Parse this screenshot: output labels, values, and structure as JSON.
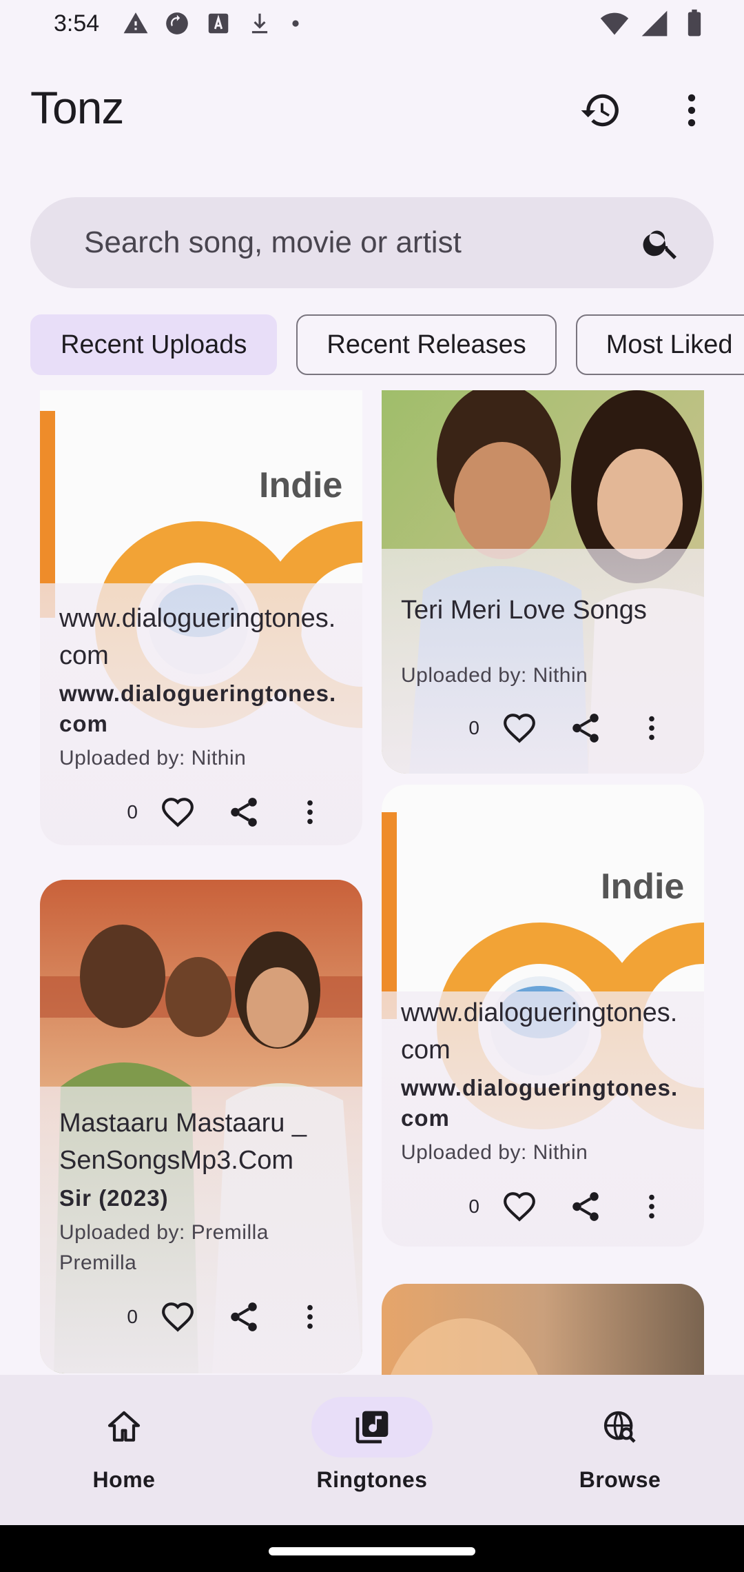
{
  "status_bar": {
    "time": "3:54",
    "left_icons": [
      "alert-icon",
      "sync-icon",
      "font-icon",
      "download-icon",
      "dot-icon"
    ],
    "right_icons": [
      "wifi-icon",
      "signal-icon",
      "battery-icon"
    ]
  },
  "app_bar": {
    "title": "Tonz",
    "actions": [
      "history-icon",
      "more-vert-icon"
    ]
  },
  "search": {
    "placeholder": "Search song, movie or artist"
  },
  "chips": [
    {
      "label": "Recent Uploads",
      "selected": true
    },
    {
      "label": "Recent Releases",
      "selected": false
    },
    {
      "label": "Most Liked",
      "selected": false
    }
  ],
  "cards": [
    {
      "title": "www.dialogueringtones.com",
      "subtitle": "www.dialogueringtones.com",
      "uploader": "Uploaded by: Nithin",
      "likes": "0",
      "image": "indie-logo"
    },
    {
      "title": "Teri Meri Love Songs",
      "subtitle": "",
      "uploader": "Uploaded by: Nithin",
      "likes": "0",
      "image": "couple-photo"
    },
    {
      "title": "www.dialogueringtones.com",
      "subtitle": "www.dialogueringtones.com",
      "uploader": "Uploaded by: Nithin",
      "likes": "0",
      "image": "indie-logo"
    },
    {
      "title": "Mastaaru Mastaaru _ SenSongsMp3.Com",
      "subtitle": "Sir (2023)",
      "uploader": "Uploaded by: Premilla Premilla",
      "likes": "0",
      "image": "movie-poster"
    },
    {
      "title": "",
      "subtitle": "",
      "uploader": "",
      "likes": "",
      "image": "warm-photo"
    }
  ],
  "bottom_nav": {
    "items": [
      {
        "label": "Home",
        "icon": "home-icon",
        "active": false
      },
      {
        "label": "Ringtones",
        "icon": "library-music-icon",
        "active": true
      },
      {
        "label": "Browse",
        "icon": "travel-explore-icon",
        "active": false
      }
    ]
  },
  "colors": {
    "background": "#f7f3fa",
    "search_bg": "#e7e1ec",
    "chip_selected": "#e8def8",
    "nav_bg": "#ece6f0",
    "accent_orange": "#f0a030"
  }
}
